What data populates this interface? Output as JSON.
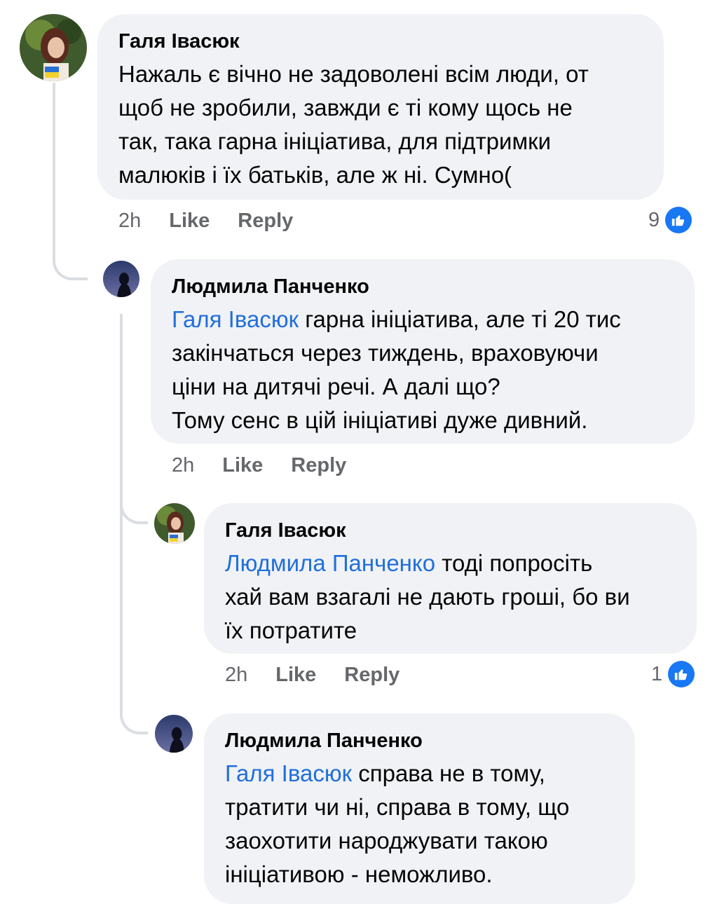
{
  "comments": [
    {
      "author": "Галя Івасюк",
      "mention": "",
      "lines": [
        "Нажаль є вічно не задоволені всім люди, от",
        "щоб не зробили, завжди є ті кому щось не",
        "так, така гарна ініціатива, для підтримки",
        "малюків і їх батьків, але ж ні. Сумно("
      ],
      "time": "2h",
      "like": "Like",
      "reply": "Reply",
      "reactions": "9"
    },
    {
      "author": "Людмила Панченко",
      "mention": "Галя Івасюк",
      "lines": [
        " гарна ініціатива, але ті 20 тис",
        "закінчаться через тиждень, враховуючи",
        "ціни на дитячі речі. А далі що?",
        "Тому сенс в цій ініціативі дуже дивний."
      ],
      "time": "2h",
      "like": "Like",
      "reply": "Reply",
      "reactions": ""
    },
    {
      "author": "Галя Івасюк",
      "mention": "Людмила Панченко",
      "lines": [
        " тоді попросіть",
        "хай вам взагалі не дають гроші, бо ви",
        "їх потратите"
      ],
      "time": "2h",
      "like": "Like",
      "reply": "Reply",
      "reactions": "1"
    },
    {
      "author": "Людмила Панченко",
      "mention": "Галя Івасюк",
      "lines": [
        " справа не в тому,",
        "тратити чи ні, справа в тому, що",
        "заохотити народжувати такою",
        "ініціативою - неможливо."
      ],
      "time": "",
      "like": "",
      "reply": "",
      "reactions": ""
    }
  ],
  "icons": {
    "reaction": "thumbs-up-icon"
  },
  "colors": {
    "bubble": "#f0f2f5",
    "mention": "#216fdb",
    "like_badge": "#1877f2",
    "meta": "#65676b"
  }
}
